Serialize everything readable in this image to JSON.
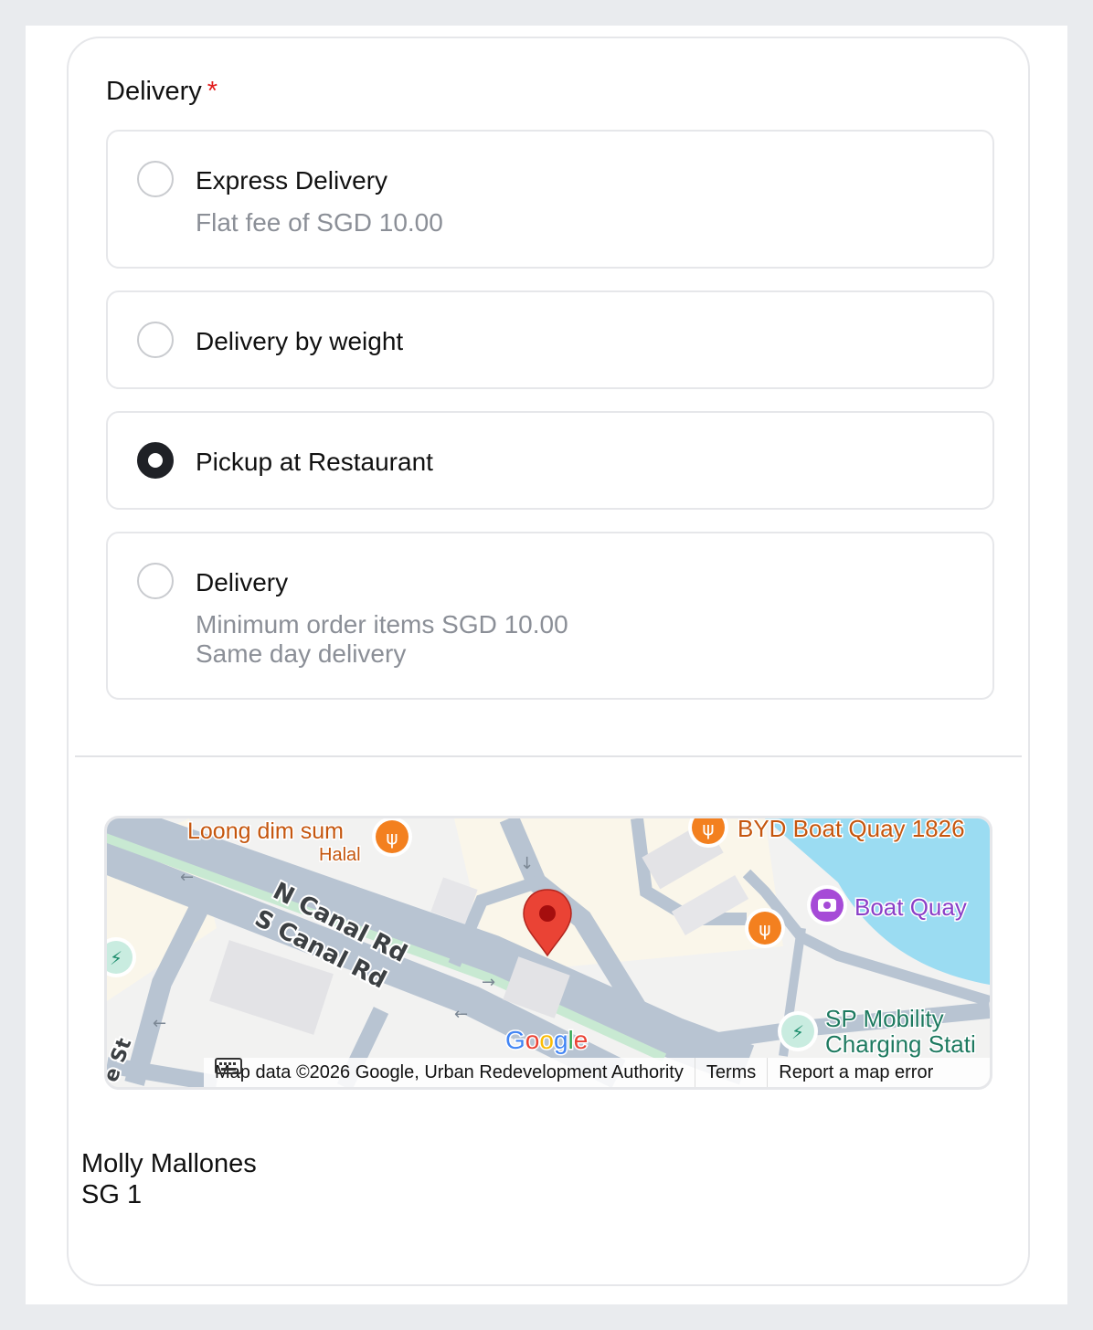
{
  "delivery": {
    "label": "Delivery",
    "required_mark": "*",
    "options": [
      {
        "title": "Express Delivery",
        "desc": [
          "Flat fee of SGD 10.00"
        ],
        "checked": false
      },
      {
        "title": "Delivery by weight",
        "desc": [],
        "checked": false
      },
      {
        "title": "Pickup at Restaurant",
        "desc": [],
        "checked": true
      },
      {
        "title": "Delivery",
        "desc": [
          "Minimum order items SGD 10.00",
          "Same day delivery"
        ],
        "checked": false
      }
    ]
  },
  "map": {
    "labels": {
      "loong": "Loong dim sum",
      "halal": "Halal",
      "byd": "BYD Boat Quay 1826",
      "boat_quay": "Boat Quay",
      "n_canal": "N Canal Rd",
      "s_canal": "S Canal Rd",
      "sp_mobility_1": "SP Mobility",
      "sp_mobility_2": "Charging Stati",
      "street_fragment": "e St",
      "google": "Google"
    },
    "attribution": {
      "data": "Map data ©2026 Google, Urban Redevelopment Authority",
      "terms": "Terms",
      "report": "Report a map error"
    },
    "colors": {
      "water": "#9bdcf2",
      "road": "#b8c4d2",
      "pin": "#ea4335",
      "restaurant": "#f3801f",
      "attraction": "#a64bd7",
      "charging": "#1e8e6e"
    }
  },
  "place": {
    "name": "Molly Mallones",
    "address": "SG 1"
  }
}
